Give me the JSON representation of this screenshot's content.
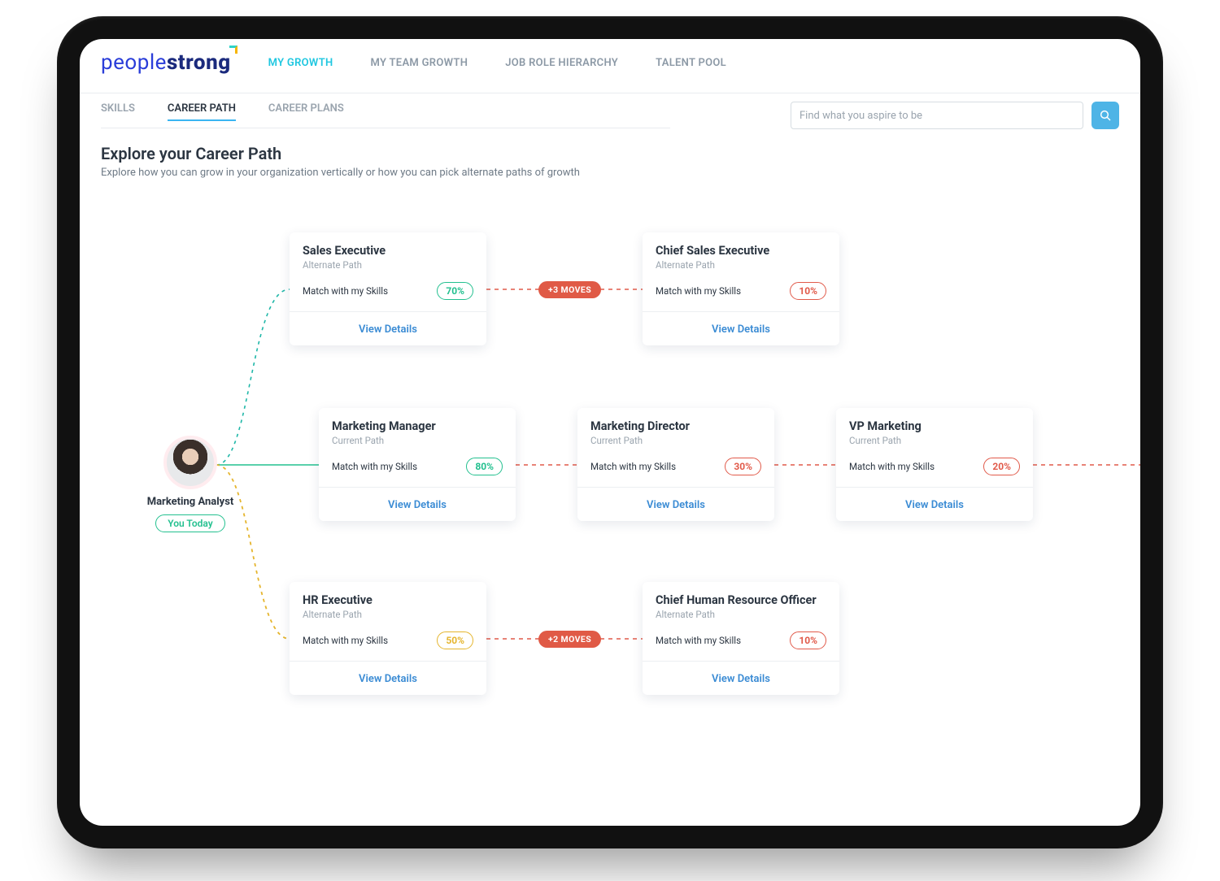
{
  "logo": {
    "p1": "people",
    "p2": "strong"
  },
  "nav": {
    "items": [
      {
        "label": "MY GROWTH",
        "active": true
      },
      {
        "label": "MY TEAM GROWTH",
        "active": false
      },
      {
        "label": "JOB ROLE HIERARCHY",
        "active": false
      },
      {
        "label": "TALENT POOL",
        "active": false
      }
    ]
  },
  "subtabs": {
    "items": [
      {
        "label": "SKILLS",
        "active": false
      },
      {
        "label": "CAREER PATH",
        "active": true
      },
      {
        "label": "CAREER PLANS",
        "active": false
      }
    ]
  },
  "search": {
    "placeholder": "Find what you aspire to be"
  },
  "headline": {
    "title": "Explore your Career Path",
    "subtitle": "Explore how you can grow in your organization vertically or how you can pick alternate paths of growth"
  },
  "origin": {
    "role": "Marketing Analyst",
    "badge": "You Today"
  },
  "common": {
    "match_label": "Match with my Skills",
    "view_label": "View Details"
  },
  "jumps": {
    "a": "+3 MOVES",
    "b": "+2 MOVES"
  },
  "cards": {
    "sales_exec": {
      "title": "Sales Executive",
      "sub": "Alternate Path",
      "match": "70%",
      "tone": "green"
    },
    "chief_sales": {
      "title": "Chief Sales Executive",
      "sub": "Alternate Path",
      "match": "10%",
      "tone": "red"
    },
    "mkt_mgr": {
      "title": "Marketing Manager",
      "sub": "Current Path",
      "match": "80%",
      "tone": "green"
    },
    "mkt_dir": {
      "title": "Marketing Director",
      "sub": "Current Path",
      "match": "30%",
      "tone": "red"
    },
    "vp_mkt": {
      "title": "VP Marketing",
      "sub": "Current Path",
      "match": "20%",
      "tone": "red"
    },
    "hr_exec": {
      "title": "HR Executive",
      "sub": "Alternate Path",
      "match": "50%",
      "tone": "yellow"
    },
    "chro": {
      "title": "Chief Human Resource Officer",
      "sub": "Alternate Path",
      "match": "10%",
      "tone": "red"
    }
  }
}
